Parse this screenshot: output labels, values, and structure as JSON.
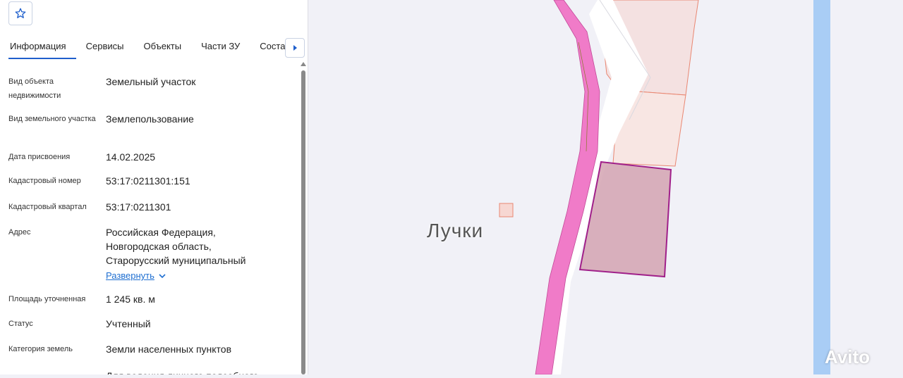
{
  "favorite": {
    "icon": "star-icon"
  },
  "tabs": [
    {
      "label": "Информация",
      "active": true
    },
    {
      "label": "Сервисы"
    },
    {
      "label": "Объекты"
    },
    {
      "label": "Части ЗУ"
    },
    {
      "label": "Состав"
    }
  ],
  "tab_scroll_icon": "caret-right-icon",
  "info": {
    "object_type": {
      "label": "Вид объекта недвижимости",
      "value": "Земельный участок"
    },
    "land_type": {
      "label": "Вид земельного участка",
      "value": "Землепользование"
    },
    "assign_date": {
      "label": "Дата присвоения",
      "value": "14.02.2025"
    },
    "cadastral_number": {
      "label": "Кадастровый номер",
      "value": "53:17:0211301:151"
    },
    "cadastral_quarter": {
      "label": "Кадастровый квартал",
      "value": "53:17:0211301"
    },
    "address": {
      "label": "Адрес",
      "line1": "Российская Федерация,",
      "line2": "Новгородская область,",
      "line3": "Старорусский муниципальный",
      "expand": "Развернуть"
    },
    "area": {
      "label": "Площадь уточненная",
      "value": "1 245 кв. м"
    },
    "status": {
      "label": "Статус",
      "value": "Учтенный"
    },
    "land_category": {
      "label": "Категория земель",
      "value": "Земли населенных пунктов"
    },
    "partial_value": "Для ведения личного подсобного"
  },
  "map": {
    "place_label": "Лучки",
    "watermark": "Avito"
  },
  "colors": {
    "accent": "#1f5fcc",
    "road_pink": "#f07bc8",
    "parcel_fill": "#d4a3b2",
    "parcel_border": "#a0208a",
    "water": "#a9cdf5"
  }
}
